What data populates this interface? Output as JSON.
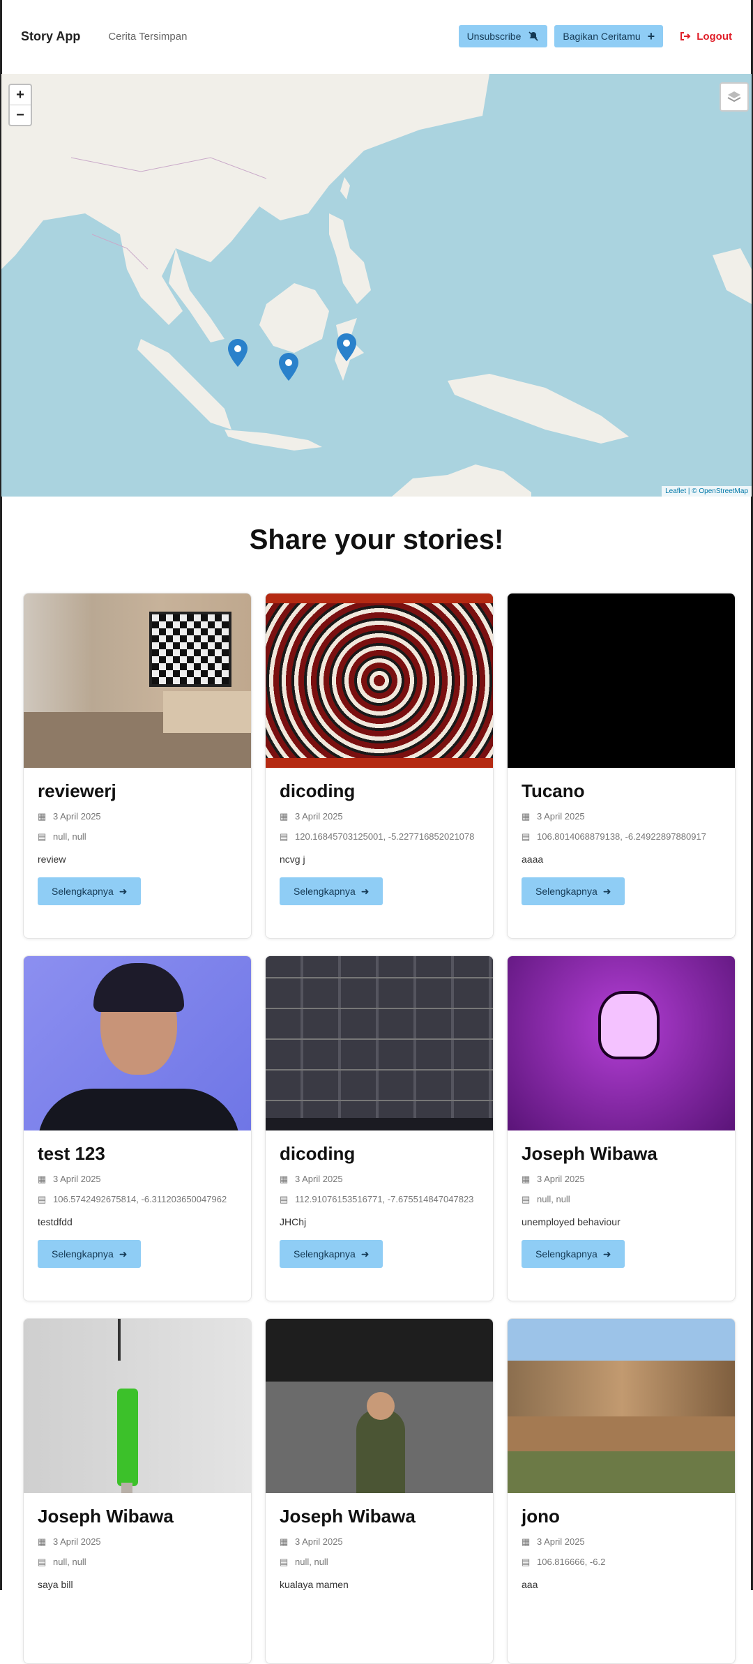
{
  "header": {
    "brand": "Story App",
    "nav_saved": "Cerita Tersimpan",
    "unsubscribe_label": "Unsubscribe",
    "share_label": "Bagikan Ceritamu",
    "logout_label": "Logout"
  },
  "map": {
    "zoom_in": "+",
    "zoom_out": "−",
    "attribution": "Leaflet | © OpenStreetMap"
  },
  "heading": "Share your stories!",
  "cards": [
    {
      "title": "reviewerj",
      "date": "3 April 2025",
      "coords": "null, null",
      "desc": "review",
      "more": "Selengkapnya"
    },
    {
      "title": "dicoding",
      "date": "3 April 2025",
      "coords": "120.16845703125001, -5.227716852021078",
      "desc": "ncvg j",
      "more": "Selengkapnya"
    },
    {
      "title": "Tucano",
      "date": "3 April 2025",
      "coords": "106.8014068879138, -6.24922897880917",
      "desc": "aaaa",
      "more": "Selengkapnya"
    },
    {
      "title": "test 123",
      "date": "3 April 2025",
      "coords": "106.5742492675814, -6.311203650047962",
      "desc": "testdfdd",
      "more": "Selengkapnya"
    },
    {
      "title": "dicoding",
      "date": "3 April 2025",
      "coords": "112.91076153516771, -7.675514847047823",
      "desc": "JHChj",
      "more": "Selengkapnya"
    },
    {
      "title": "Joseph Wibawa",
      "date": "3 April 2025",
      "coords": "null, null",
      "desc": "unemployed behaviour",
      "more": "Selengkapnya"
    },
    {
      "title": "Joseph Wibawa",
      "date": "3 April 2025",
      "coords": "null, null",
      "desc": "saya bill",
      "more": "Selengkapnya"
    },
    {
      "title": "Joseph Wibawa",
      "date": "3 April 2025",
      "coords": "null, null",
      "desc": "kualaya mamen",
      "more": "Selengkapnya"
    },
    {
      "title": "jono",
      "date": "3 April 2025",
      "coords": "106.816666, -6.2",
      "desc": "aaa",
      "more": "Selengkapnya"
    }
  ],
  "colors": {
    "accent": "#8fcdf5",
    "logout": "#e0202a",
    "marker": "#2a81cb"
  }
}
